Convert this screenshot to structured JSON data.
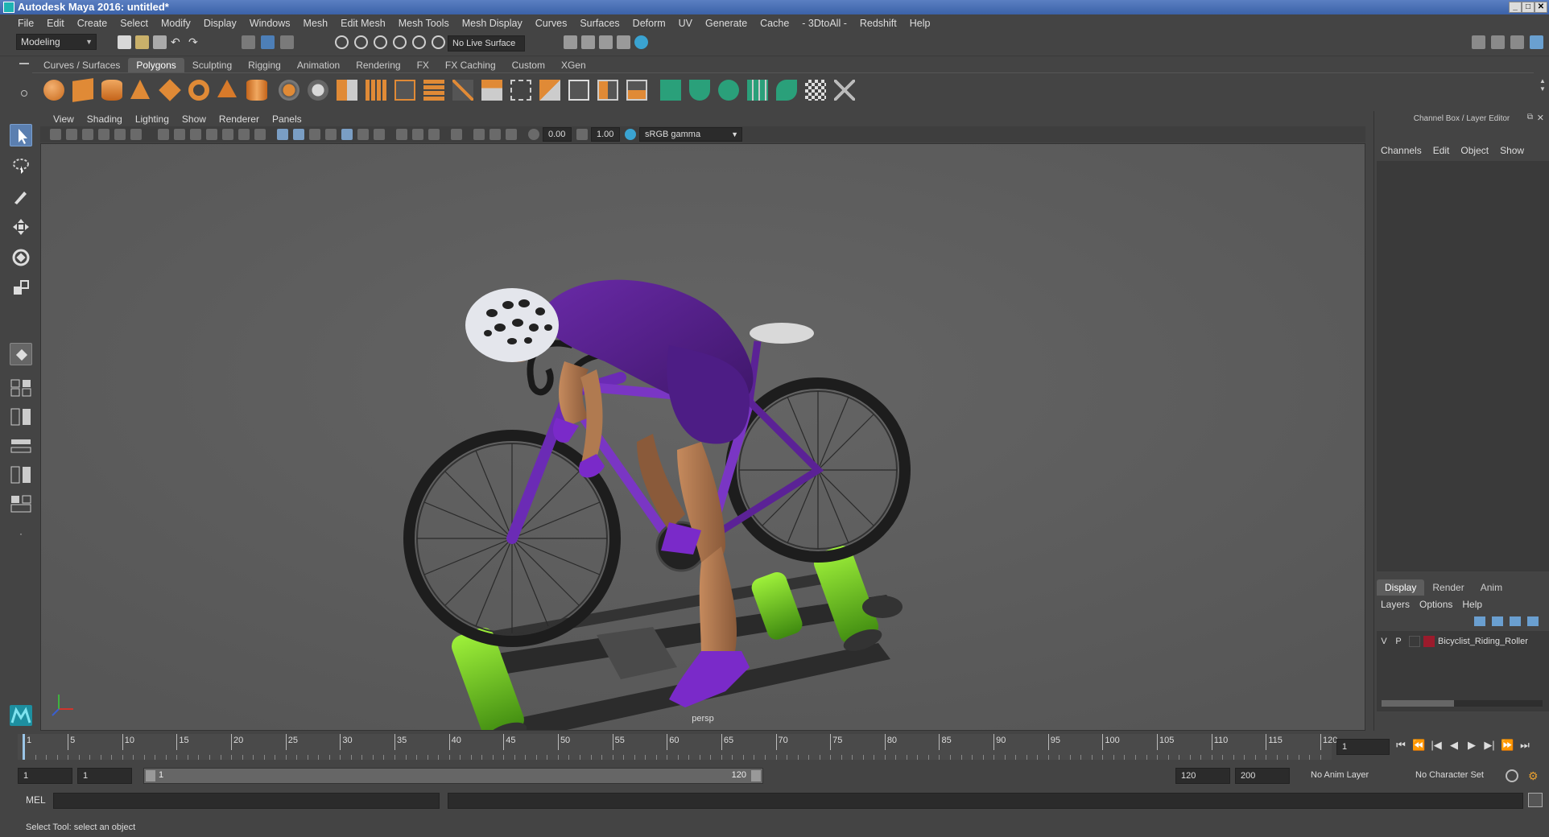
{
  "window": {
    "title": "Autodesk Maya 2016: untitled*"
  },
  "menus": [
    "File",
    "Edit",
    "Create",
    "Select",
    "Modify",
    "Display",
    "Windows",
    "Mesh",
    "Edit Mesh",
    "Mesh Tools",
    "Mesh Display",
    "Curves",
    "Surfaces",
    "Deform",
    "UV",
    "Generate",
    "Cache",
    "- 3DtoAll -",
    "Redshift",
    "Help"
  ],
  "toolbar": {
    "mode": "Modeling",
    "live_surface": "No Live Surface"
  },
  "shelf_tabs": [
    "Curves / Surfaces",
    "Polygons",
    "Sculpting",
    "Rigging",
    "Animation",
    "Rendering",
    "FX",
    "FX Caching",
    "Custom",
    "XGen"
  ],
  "shelf_active": "Polygons",
  "viewport": {
    "menus": [
      "View",
      "Shading",
      "Lighting",
      "Show",
      "Renderer",
      "Panels"
    ],
    "exposure": "0.00",
    "gamma": "1.00",
    "color_space": "sRGB gamma",
    "camera_label": "persp"
  },
  "channel_box": {
    "title": "Channel Box / Layer Editor",
    "menus": [
      "Channels",
      "Edit",
      "Object",
      "Show"
    ]
  },
  "layer_editor": {
    "tabs": [
      "Display",
      "Render",
      "Anim"
    ],
    "active_tab": "Display",
    "menus": [
      "Layers",
      "Options",
      "Help"
    ],
    "layer": {
      "v": "V",
      "p": "P",
      "name": "Bicyclist_Riding_Roller",
      "color": "#9b1b2c"
    }
  },
  "timeline": {
    "ticks": [
      "1",
      "5",
      "10",
      "15",
      "20",
      "25",
      "30",
      "35",
      "40",
      "45",
      "50",
      "55",
      "60",
      "65",
      "70",
      "75",
      "80",
      "85",
      "90",
      "95",
      "100",
      "105",
      "110",
      "115",
      "120"
    ],
    "current_frame": "1"
  },
  "range": {
    "start": "1",
    "playback_start": "1",
    "slider_start": "1",
    "slider_end": "120",
    "playback_end": "120",
    "end": "200",
    "anim_layer": "No Anim Layer",
    "character_set": "No Character Set"
  },
  "command_line": {
    "label": "MEL"
  },
  "status_bar": {
    "message": "Select Tool: select an object"
  }
}
